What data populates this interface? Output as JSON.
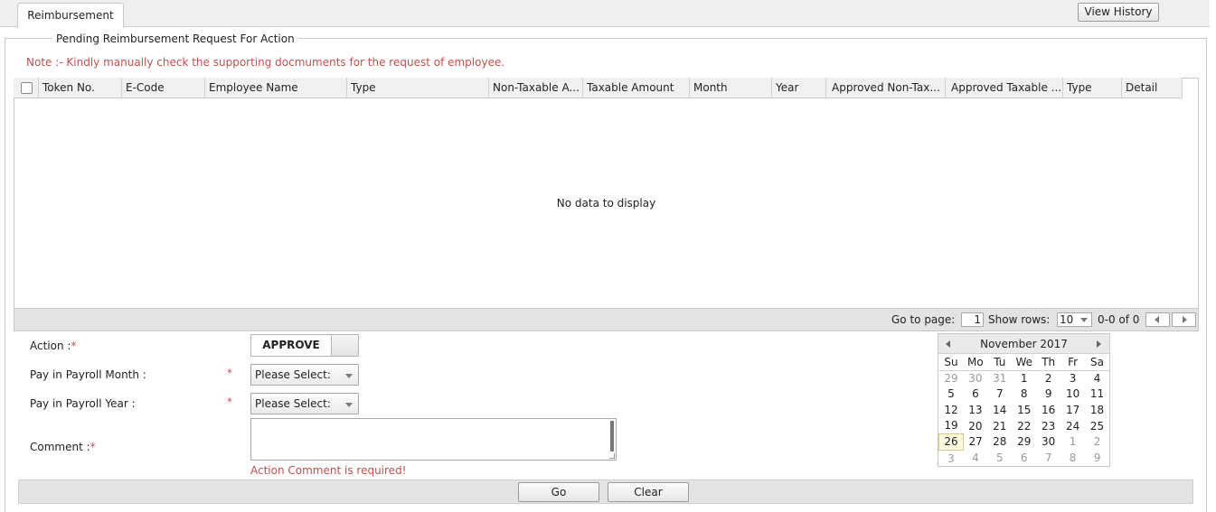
{
  "tabs": {
    "active": "Reimbursement"
  },
  "header": {
    "view_history": "View History"
  },
  "section": {
    "title": "Pending Reimbursement Request For Action",
    "note": "Note :- Kindly manually check the supporting docmuments for the request of employee."
  },
  "grid": {
    "columns": [
      "Token No.",
      "E-Code",
      "Employee Name",
      "Type",
      "Non-Taxable A...",
      "Taxable Amount",
      "Month",
      "Year",
      "Approved Non-Tax...",
      "Approved Taxable ...",
      "Type",
      "Detail"
    ],
    "empty_text": "No data to display",
    "pager": {
      "goto_label": "Go to page:",
      "page_value": "1",
      "show_rows_label": "Show rows:",
      "rows_value": "10",
      "range": "0-0 of 0"
    }
  },
  "form": {
    "action_label": "Action :",
    "action_value": "APPROVE",
    "month_label": "Pay in Payroll Month :",
    "month_value": "Please Select:",
    "year_label": "Pay in Payroll Year :",
    "year_value": "Please Select:",
    "comment_label": "Comment :",
    "comment_value": "",
    "required_marker": "*",
    "error": "Action Comment is required!"
  },
  "calendar": {
    "title": "November 2017",
    "days_of_week": [
      "Su",
      "Mo",
      "Tu",
      "We",
      "Th",
      "Fr",
      "Sa"
    ],
    "weeks": [
      [
        "29",
        "30",
        "31",
        "1",
        "2",
        "3",
        "4"
      ],
      [
        "5",
        "6",
        "7",
        "8",
        "9",
        "10",
        "11"
      ],
      [
        "12",
        "13",
        "14",
        "15",
        "16",
        "17",
        "18"
      ],
      [
        "19",
        "20",
        "21",
        "22",
        "23",
        "24",
        "25"
      ],
      [
        "26",
        "27",
        "28",
        "29",
        "30",
        "1",
        "2"
      ],
      [
        "3",
        "4",
        "5",
        "6",
        "7",
        "8",
        "9"
      ]
    ],
    "today": "26"
  },
  "buttons": {
    "go": "Go",
    "clear": "Clear"
  },
  "colors": {
    "error": "#c0504d",
    "header_bg": "#f1f1f1",
    "footer_bg": "#e3e3e3"
  }
}
